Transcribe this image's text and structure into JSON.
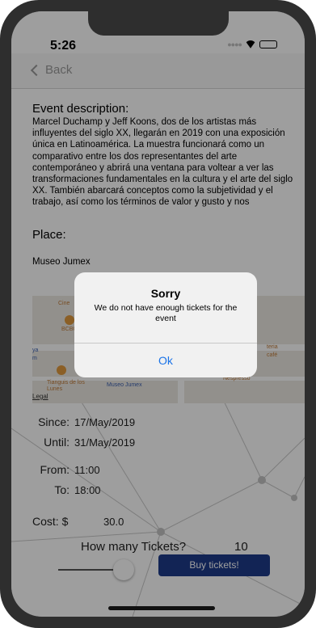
{
  "status": {
    "time": "5:26"
  },
  "nav": {
    "back_label": "Back"
  },
  "event": {
    "description_label": "Event description:",
    "description": "Marcel Duchamp y Jeff Koons, dos de los artistas más influyentes del siglo XX, llegarán en 2019 con una exposición única en Latinoamérica. La muestra funcionará como un comparativo entre los dos representantes del arte contemporáneo y abrirá una ventana para voltear a ver las transformaciones fundamentales en la cultura y el arte del siglo XX. También abarcará conceptos como la subjetividad y el trabajo, así como los términos de valor y gusto y nos",
    "place_label": "Place:",
    "place": "Museo Jumex"
  },
  "map": {
    "labels": [
      "Cine",
      "BCBG",
      "ya",
      "m",
      "Tianguis de los Lunes",
      "Museo Jumex",
      "Nespresso",
      "teria",
      "café"
    ],
    "legal": "Legal"
  },
  "schedule": {
    "since_label": "Since:",
    "since": "17/May/2019",
    "until_label": "Until:",
    "until": "31/May/2019",
    "from_label": "From:",
    "from": "11:00",
    "to_label": "To:",
    "to": "18:00"
  },
  "cost": {
    "label": "Cost: $",
    "value": "30.0"
  },
  "tickets": {
    "label": "How many Tickets?",
    "count": "10",
    "slider_value": 10,
    "buy_label": "Buy tickets!"
  },
  "alert": {
    "title": "Sorry",
    "message": "We do not have enough tickets for the event",
    "ok_label": "Ok"
  },
  "colors": {
    "accent": "#1a73e8",
    "button": "#1d3a8a"
  }
}
